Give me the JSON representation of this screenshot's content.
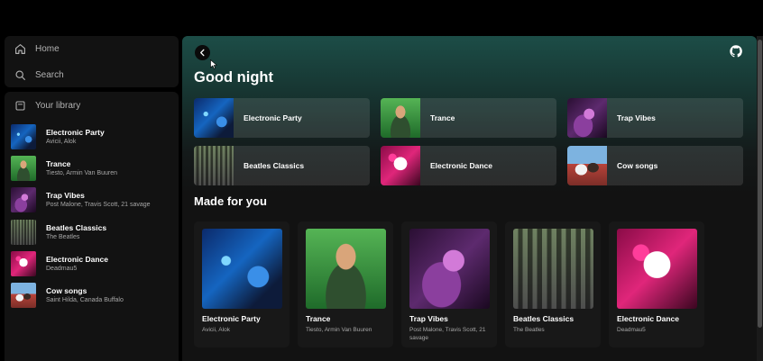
{
  "nav": {
    "home_label": "Home",
    "search_label": "Search"
  },
  "library": {
    "header_label": "Your library",
    "items": [
      {
        "title": "Electronic Party",
        "subtitle": "Avicii, Alok",
        "art": "art-party"
      },
      {
        "title": "Trance",
        "subtitle": "Tiesto, Armin Van Buuren",
        "art": "art-trance"
      },
      {
        "title": "Trap Vibes",
        "subtitle": "Post Malone, Travis Scott, 21 savage",
        "art": "art-trap"
      },
      {
        "title": "Beatles Classics",
        "subtitle": "The Beatles",
        "art": "art-beatles"
      },
      {
        "title": "Electronic Dance",
        "subtitle": "Deadmau5",
        "art": "art-dance"
      },
      {
        "title": "Cow songs",
        "subtitle": "Saint Hilda, Canada Buffalo",
        "art": "art-cow"
      }
    ]
  },
  "main": {
    "greeting": "Good night",
    "quick_picks": [
      {
        "label": "Electronic Party",
        "art": "art-party"
      },
      {
        "label": "Trance",
        "art": "art-trance"
      },
      {
        "label": "Trap Vibes",
        "art": "art-trap"
      },
      {
        "label": "Beatles Classics",
        "art": "art-beatles"
      },
      {
        "label": "Electronic Dance",
        "art": "art-dance"
      },
      {
        "label": "Cow songs",
        "art": "art-cow"
      }
    ],
    "made_for_you_title": "Made for you",
    "made_for_you": [
      {
        "title": "Electronic Party",
        "subtitle": "Avicii, Alok",
        "art": "art-party"
      },
      {
        "title": "Trance",
        "subtitle": "Tiesto, Armin Van Buuren",
        "art": "art-trance"
      },
      {
        "title": "Trap Vibes",
        "subtitle": "Post Malone, Travis Scott, 21 savage",
        "art": "art-trap"
      },
      {
        "title": "Beatles Classics",
        "subtitle": "The Beatles",
        "art": "art-beatles"
      },
      {
        "title": "Electronic Dance",
        "subtitle": "Deadmau5",
        "art": "art-dance"
      }
    ]
  },
  "icons": {
    "home": "home-icon",
    "search": "search-icon",
    "library": "library-icon",
    "back": "chevron-left-icon",
    "github": "github-icon"
  },
  "colors": {
    "accent_gradient_top": "#1c4d47",
    "panel": "#121212",
    "card": "#181818"
  }
}
